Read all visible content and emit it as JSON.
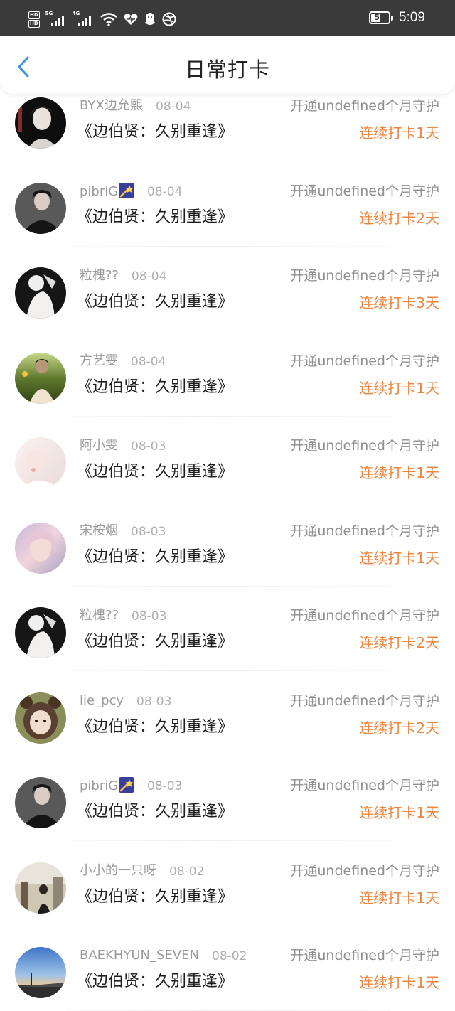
{
  "status_bar": {
    "hd_badges": [
      "HD",
      "HD"
    ],
    "network_1": "5G",
    "network_2": "4G",
    "battery_level": 53,
    "battery_label": "53",
    "time": "5:09",
    "icons": [
      "signal-icon",
      "wifi-icon",
      "heart-icon",
      "qq-icon",
      "dribbble-icon",
      "battery-icon"
    ]
  },
  "header": {
    "back_icon": "chevron-left-icon",
    "title": "日常打卡",
    "accent_color": "#3d8fe5"
  },
  "colors": {
    "streak": "#ee8640",
    "name": "#9a9a9a",
    "title": "#1e1e1e"
  },
  "checkins": [
    {
      "user": "BYX边允熙",
      "star": false,
      "date": "08-04",
      "guard": "开通undefined个月守护",
      "book": "《边伯贤：久别重逢》",
      "streak": "连续打卡1天",
      "avatar": "avatar-dark-portrait"
    },
    {
      "user": "pibriG",
      "star": true,
      "date": "08-04",
      "guard": "开通undefined个月守护",
      "book": "《边伯贤：久别重逢》",
      "streak": "连续打卡2天",
      "avatar": "avatar-black-outfit"
    },
    {
      "user": "粒槐??",
      "star": false,
      "date": "08-04",
      "guard": "开通undefined个月守护",
      "book": "《边伯贤：久别重逢》",
      "streak": "连续打卡3天",
      "avatar": "avatar-white-lace"
    },
    {
      "user": "方艺雯",
      "star": false,
      "date": "08-04",
      "guard": "开通undefined个月守护",
      "book": "《边伯贤：久别重逢》",
      "streak": "连续打卡1天",
      "avatar": "avatar-outdoor-sunflower"
    },
    {
      "user": "阿小雯",
      "star": false,
      "date": "08-03",
      "guard": "开通undefined个月守护",
      "book": "《边伯贤：久别重逢》",
      "streak": "连续打卡1天",
      "avatar": "avatar-pale-white"
    },
    {
      "user": "宋桉烟",
      "star": false,
      "date": "08-03",
      "guard": "开通undefined个月守护",
      "book": "《边伯贤：久别重逢》",
      "streak": "连续打卡1天",
      "avatar": "avatar-pink-hair"
    },
    {
      "user": "粒槐??",
      "star": false,
      "date": "08-03",
      "guard": "开通undefined个月守护",
      "book": "《边伯贤：久别重逢》",
      "streak": "连续打卡2天",
      "avatar": "avatar-white-lace"
    },
    {
      "user": "lie_pcy",
      "star": false,
      "date": "08-03",
      "guard": "开通undefined个月守护",
      "book": "《边伯贤：久别重逢》",
      "streak": "连续打卡2天",
      "avatar": "avatar-bear-hood"
    },
    {
      "user": "pibriG",
      "star": true,
      "date": "08-03",
      "guard": "开通undefined个月守护",
      "book": "《边伯贤：久别重逢》",
      "streak": "连续打卡1天",
      "avatar": "avatar-black-outfit"
    },
    {
      "user": "小小的一只呀",
      "star": false,
      "date": "08-02",
      "guard": "开通undefined个月守护",
      "book": "《边伯贤：久别重逢》",
      "streak": "连续打卡1天",
      "avatar": "avatar-street-scene"
    },
    {
      "user": "BAEKHYUN_SEVEN",
      "star": false,
      "date": "08-02",
      "guard": "开通undefined个月守护",
      "book": "《边伯贤：久别重逢》",
      "streak": "连续打卡1天",
      "avatar": "avatar-sky-landscape"
    }
  ]
}
